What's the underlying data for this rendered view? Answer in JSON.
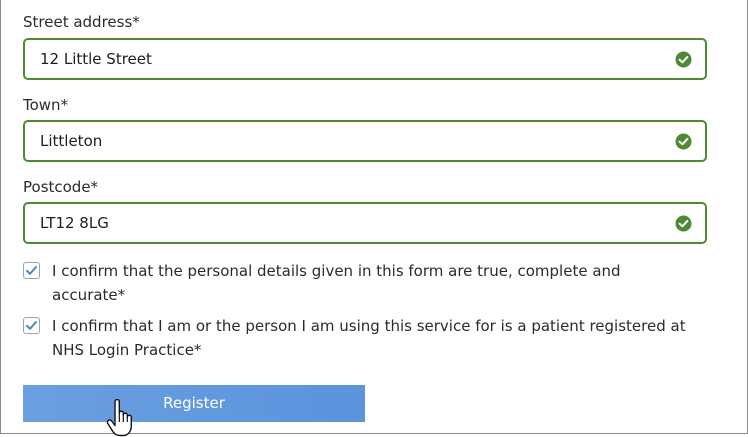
{
  "fields": [
    {
      "label": "Street address*",
      "value": "12 Little Street",
      "status": "valid"
    },
    {
      "label": "Town*",
      "value": "Littleton",
      "status": "valid"
    },
    {
      "label": "Postcode*",
      "value": "LT12 8LG",
      "status": "valid"
    }
  ],
  "confirmations": [
    {
      "checked": true,
      "line1": "I confirm that the personal details given in this form are true, complete and",
      "line2": "accurate*"
    },
    {
      "checked": true,
      "line1": "I confirm that I am or the person I am using this service for is a patient registered at",
      "line2": "NHS Login Practice*"
    }
  ],
  "register_button": {
    "label": "Register"
  },
  "colors": {
    "valid_border": "#4f8a33",
    "valid_icon": "#4f8a33",
    "button": "#5b93dc",
    "checkbox_tick": "#4a86c7"
  },
  "icons": {
    "valid": "check-circle-icon",
    "checkbox": "checkmark-icon",
    "cursor": "hand-pointer-icon"
  }
}
